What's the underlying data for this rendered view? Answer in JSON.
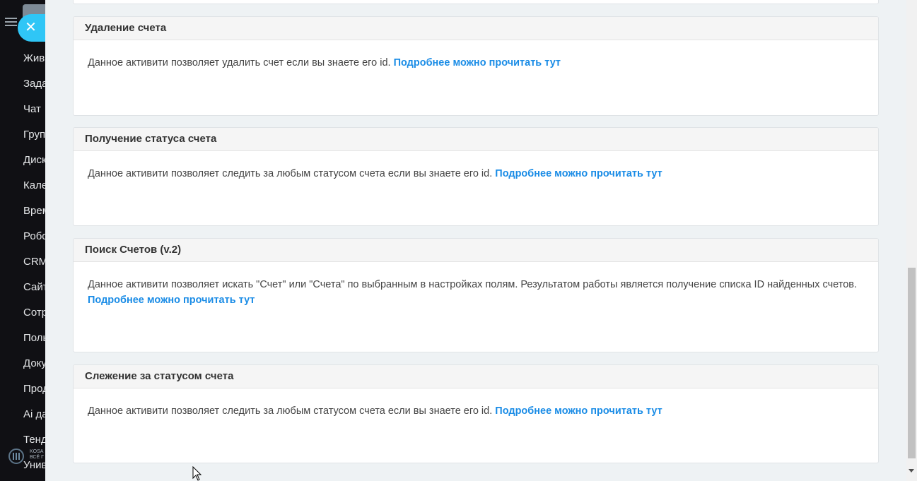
{
  "sidebar": {
    "items": [
      {
        "label": "Жив"
      },
      {
        "label": "Зада"
      },
      {
        "label": "Чат"
      },
      {
        "label": "Груп"
      },
      {
        "label": "Диск"
      },
      {
        "label": "Кале"
      },
      {
        "label": "Врем"
      },
      {
        "label": "Робо"
      },
      {
        "label": "CRM"
      },
      {
        "label": "Сайт"
      },
      {
        "label": "Сотр"
      },
      {
        "label": "Поль"
      },
      {
        "label": "Доку"
      },
      {
        "label": "Прод"
      },
      {
        "label": "Ai да"
      },
      {
        "label": "Тенд"
      },
      {
        "label": "Унив"
      }
    ],
    "close_symbol": "✕",
    "logo_text_line1": "KOSA",
    "logo_text_line2": "ВСЁ Г"
  },
  "cards": [
    {
      "title": "Удаление счета",
      "text": "Данное активити позволяет удалить счет если вы знаете его id.",
      "link": "Подробнее можно прочитать тут"
    },
    {
      "title": "Получение статуса счета",
      "text": "Данное активити позволяет следить за любым статусом счета если вы знаете его id.",
      "link": "Подробнее можно прочитать тут"
    },
    {
      "title": "Поиск Счетов (v.2)",
      "text": "Данное активити позволяет искать \"Счет\" или \"Счета\" по выбранным в настройках полям. Результатом работы является получение списка ID найденных счетов.",
      "link": "Подробнее можно прочитать тут"
    },
    {
      "title": "Слежение за статусом счета",
      "text": "Данное активити позволяет следить за любым статусом счета если вы знаете его id.",
      "link": "Подробнее можно прочитать тут"
    }
  ],
  "colors": {
    "link": "#1a8ce6",
    "close_button": "#2fc6f6",
    "sidebar_bg": "#101014"
  }
}
